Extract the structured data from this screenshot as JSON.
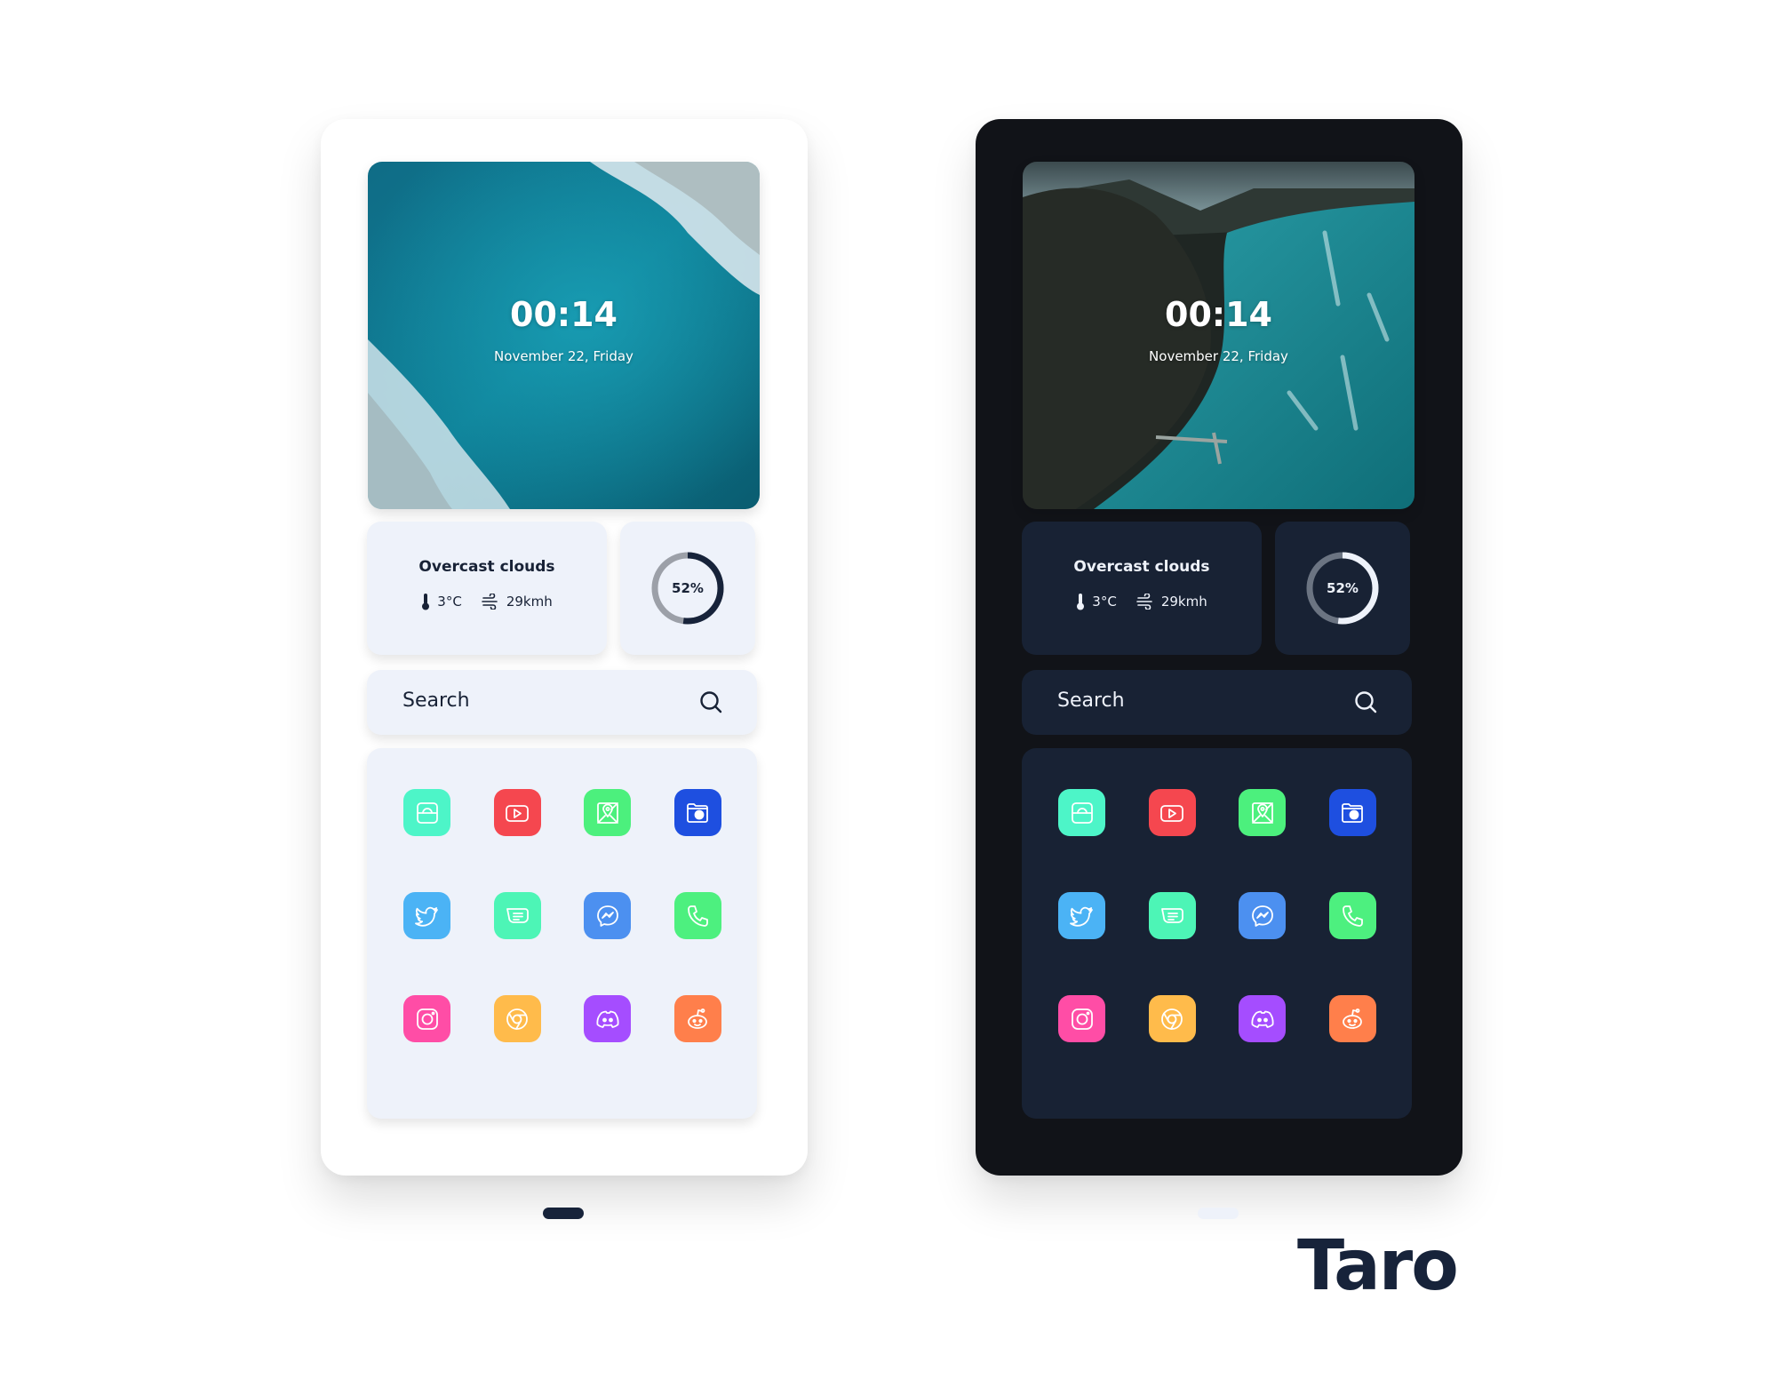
{
  "brand": "Taro",
  "phones": [
    {
      "theme": "light",
      "wallpaper": "ocean-waves-aerial",
      "clock": "00:14",
      "date": "November 22, Friday",
      "weather": {
        "condition": "Overcast clouds",
        "temperature": "3°C",
        "wind": "29kmh",
        "temperature_icon": "thermometer-icon",
        "wind_icon": "wind-icon"
      },
      "battery": {
        "percent": 52,
        "label": "52%"
      },
      "search": {
        "placeholder": "Search",
        "icon": "search-icon"
      },
      "colors": {
        "ring_fill": "#17233A",
        "ring_track": "#9CA0A8"
      }
    },
    {
      "theme": "dark",
      "wallpaper": "coastline-mountain-aerial",
      "clock": "00:14",
      "date": "November 22, Friday",
      "weather": {
        "condition": "Overcast clouds",
        "temperature": "3°C",
        "wind": "29kmh",
        "temperature_icon": "thermometer-icon",
        "wind_icon": "wind-icon"
      },
      "battery": {
        "percent": 52,
        "label": "52%"
      },
      "search": {
        "placeholder": "Search",
        "icon": "search-icon"
      },
      "colors": {
        "ring_fill": "#EEF2FA",
        "ring_track": "#6B7482"
      }
    }
  ],
  "apps": [
    {
      "name": "store",
      "icon": "shopping-bag-icon",
      "color": "#4DF5C8"
    },
    {
      "name": "youtube",
      "icon": "youtube-icon",
      "color": "#F5474F"
    },
    {
      "name": "maps",
      "icon": "map-pin-icon",
      "color": "#4CF07D"
    },
    {
      "name": "files",
      "icon": "folder-icon",
      "color": "#1E4FE0"
    },
    {
      "name": "twitter",
      "icon": "twitter-icon",
      "color": "#4BB3F5"
    },
    {
      "name": "messages",
      "icon": "message-icon",
      "color": "#4DF5B6"
    },
    {
      "name": "messenger",
      "icon": "messenger-icon",
      "color": "#4C90F0"
    },
    {
      "name": "phone",
      "icon": "phone-icon",
      "color": "#4DF07F"
    },
    {
      "name": "instagram",
      "icon": "instagram-icon",
      "color": "#FF4DA6"
    },
    {
      "name": "chrome",
      "icon": "chrome-icon",
      "color": "#FFBB4B"
    },
    {
      "name": "discord",
      "icon": "discord-icon",
      "color": "#A54DFF"
    },
    {
      "name": "reddit",
      "icon": "reddit-icon",
      "color": "#FF7F4B"
    }
  ]
}
